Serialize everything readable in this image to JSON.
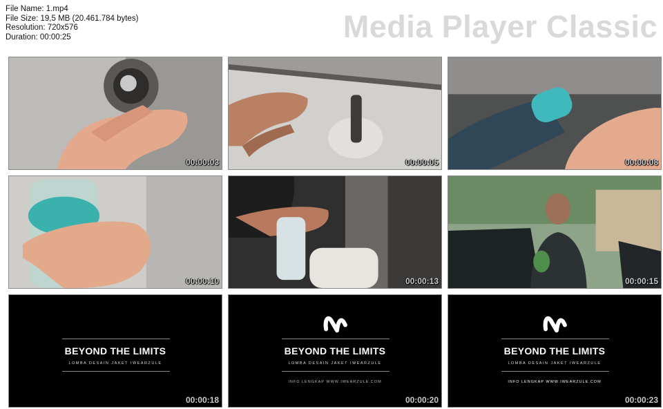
{
  "meta": {
    "file_name": "File Name: 1.mp4",
    "file_size": "File Size: 19,5 MB (20.461.784 bytes)",
    "resolution": "Resolution: 720x576",
    "duration": "Duration: 00:00:25"
  },
  "brand": "Media Player Classic",
  "thumbnails": [
    {
      "time": "00:00:03",
      "scene": "hand-knob-icon"
    },
    {
      "time": "00:00:05",
      "scene": "door-lock-icon"
    },
    {
      "time": "00:00:08",
      "scene": "bottle-cap-icon"
    },
    {
      "time": "00:00:10",
      "scene": "hand-bottle-icon"
    },
    {
      "time": "00:00:13",
      "scene": "bottle-holder-icon"
    },
    {
      "time": "00:00:15",
      "scene": "man-car-icon"
    },
    {
      "time": "00:00:18",
      "title": "BEYOND THE LIMITS",
      "subtitle": "LOMBA DESAIN JAKET IWEARZULE"
    },
    {
      "time": "00:00:20",
      "title": "BEYOND THE LIMITS",
      "subtitle": "LOMBA DESAIN JAKET IWEARZULE",
      "info": "INFO LENGKAP WWW.IWEARZULE.COM"
    },
    {
      "time": "00:00:23",
      "title": "BEYOND THE LIMITS",
      "subtitle": "LOMBA DESAIN JAKET IWEARZULE",
      "info": "INFO LENGKAP WWW.IWEARZULE.COM"
    }
  ]
}
